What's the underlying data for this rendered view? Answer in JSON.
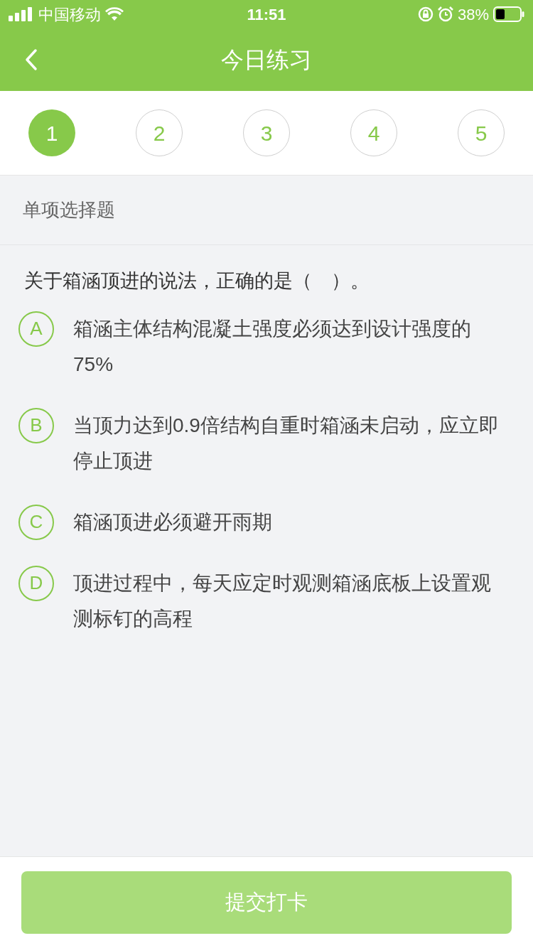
{
  "status_bar": {
    "carrier": "中国移动",
    "time": "11:51",
    "battery": "38%"
  },
  "header": {
    "title": "今日练习"
  },
  "steps": [
    {
      "label": "1",
      "selected": true
    },
    {
      "label": "2",
      "selected": false
    },
    {
      "label": "3",
      "selected": false
    },
    {
      "label": "4",
      "selected": false
    },
    {
      "label": "5",
      "selected": false
    }
  ],
  "section": {
    "title": "单项选择题"
  },
  "question": {
    "text": "关于箱涵顶进的说法，正确的是（　）。",
    "options": [
      {
        "letter": "A",
        "text": "箱涵主体结构混凝土强度必须达到设计强度的75%",
        "selected": false
      },
      {
        "letter": "B",
        "text": "当顶力达到0.9倍结构自重时箱涵未启动，应立即停止顶进",
        "selected": false
      },
      {
        "letter": "C",
        "text": "箱涵顶进必须避开雨期",
        "selected": false
      },
      {
        "letter": "D",
        "text": "顶进过程中，每天应定时观测箱涵底板上设置观测标钉的高程",
        "selected": false
      }
    ]
  },
  "submit": {
    "label": "提交打卡",
    "disabled": true
  }
}
